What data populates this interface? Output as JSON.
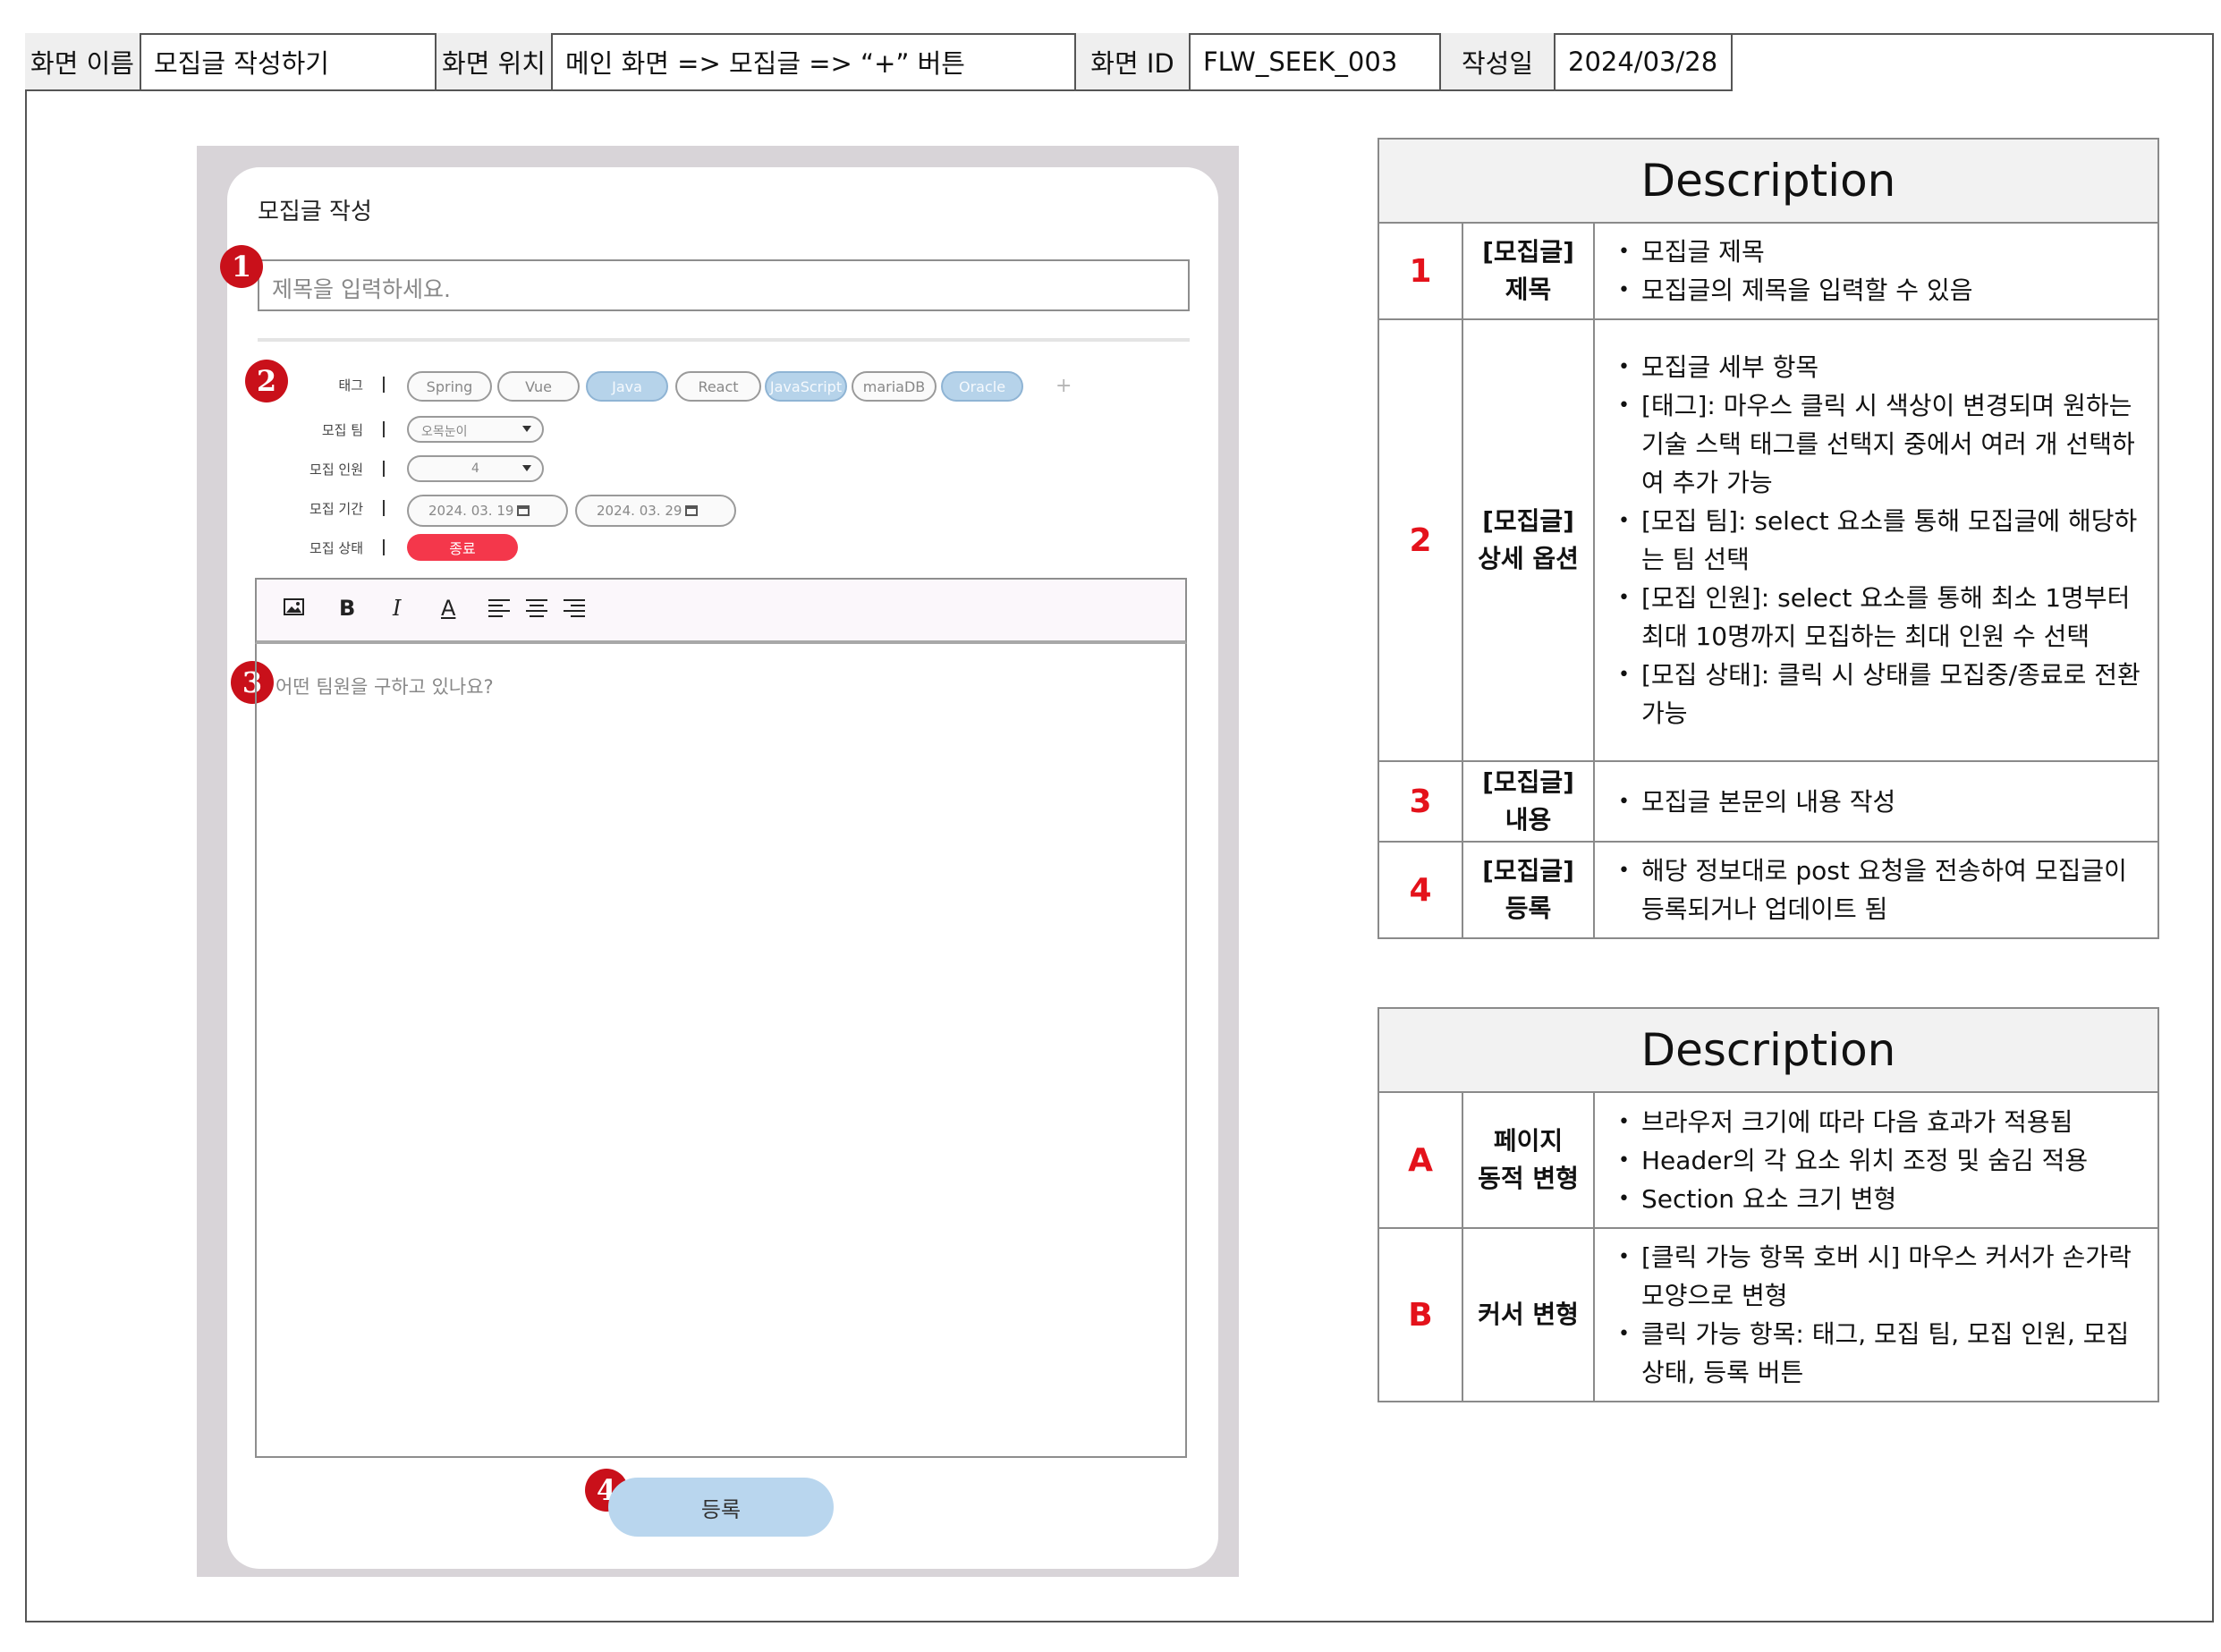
{
  "header": {
    "screen_name_label": "화면 이름",
    "screen_name": "모집글 작성하기",
    "screen_location_label": "화면 위치",
    "screen_location": "메인 화면 => 모집글 => “+” 버튼",
    "screen_id_label": "화면 ID",
    "screen_id": "FLW_SEEK_003",
    "date_label": "작성일",
    "date": "2024/03/28"
  },
  "mock": {
    "card_title": "모집글 작성",
    "title_placeholder": "제목을 입력하세요.",
    "labels": {
      "tag": "태그",
      "team": "모집 팀",
      "members": "모집 인원",
      "period": "모집 기간",
      "status": "모집 상태"
    },
    "tags": [
      {
        "label": "Spring",
        "selected": false
      },
      {
        "label": "Vue",
        "selected": false
      },
      {
        "label": "Java",
        "selected": true
      },
      {
        "label": "React",
        "selected": false
      },
      {
        "label": "JavaScript",
        "selected": true
      },
      {
        "label": "mariaDB",
        "selected": false
      },
      {
        "label": "Oracle",
        "selected": true
      }
    ],
    "add_tag": "+",
    "team_value": "오목눈이",
    "members_value": "4",
    "period_start": "2024. 03. 19",
    "period_end": "2024. 03. 29",
    "status_value": "종료",
    "editor_placeholder": "어떤 팀원을 구하고 있나요?",
    "submit_label": "등록",
    "toolbar": [
      "image-icon",
      "bold-icon",
      "italic-icon",
      "font-color-icon",
      "align-left-icon",
      "align-center-icon",
      "align-right-icon"
    ],
    "toolbar_text": {
      "bold": "B",
      "italic": "I",
      "font_color": "A"
    },
    "markers": [
      "1",
      "2",
      "3",
      "4"
    ],
    "status_color": "#f4374b",
    "selected_tag_color": "#b6d3ea"
  },
  "desc1": {
    "title": "Description",
    "rows": [
      {
        "num": "1",
        "cat1": "[모집글]",
        "cat2": "제목",
        "b1": "모집글 제목",
        "s1": "모집글의 제목을 입력할 수 있음"
      },
      {
        "num": "2",
        "cat1": "[모집글]",
        "cat2": "상세 옵션",
        "b1": "모집글 세부 항목",
        "s1": "[태그]: 마우스 클릭 시 색상이 변경되며 원하는 기술 스택 태그를 선택지 중에서 여러 개 선택하여 추가 가능",
        "s2": "[모집 팀]: select 요소를 통해 모집글에 해당하는 팀 선택",
        "s3": "[모집 인원]: select 요소를 통해 최소 1명부터 최대 10명까지 모집하는 최대 인원 수 선택",
        "s4": "[모집 상태]: 클릭 시 상태를 모집중/종료로 전환 가능"
      },
      {
        "num": "3",
        "cat1": "[모집글]",
        "cat2": "내용",
        "b1": "모집글 본문의 내용 작성"
      },
      {
        "num": "4",
        "cat1": "[모집글]",
        "cat2": "등록",
        "b1": "해당 정보대로 post 요청을 전송하여 모집글이 등록되거나 업데이트 됨"
      }
    ]
  },
  "desc2": {
    "title": "Description",
    "rows": [
      {
        "num": "A",
        "cat1": "페이지",
        "cat2": "동적 변형",
        "b1": "브라우저 크기에 따라 다음 효과가 적용됨",
        "s1": "Header의 각 요소 위치 조정 및 숨김 적용",
        "s2": "Section 요소 크기 변형"
      },
      {
        "num": "B",
        "cat1": "커서 변형",
        "b1": "[클릭 가능 항목 호버 시] 마우스 커서가 손가락 모양으로 변형",
        "s1": "클릭 가능 항목: 태그, 모집 팀, 모집 인원, 모집 상태, 등록 버튼"
      }
    ]
  }
}
